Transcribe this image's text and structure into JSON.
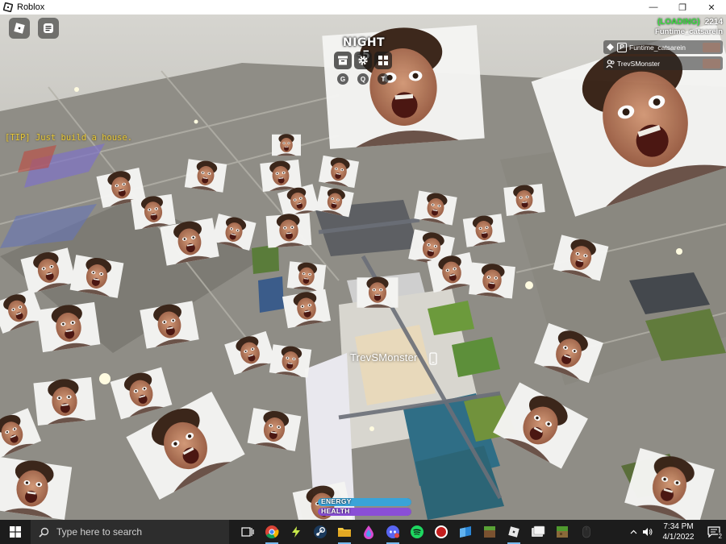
{
  "window": {
    "title": "Roblox",
    "controls": {
      "minimize": "—",
      "maximize": "❐",
      "close": "✕"
    }
  },
  "game": {
    "night_label": "NIGHT -5",
    "tip": "[TIP] Just build a house.",
    "toolbar": {
      "icons": [
        "archive-icon",
        "gear-icon",
        "grid-icon"
      ],
      "key_hints": [
        "G",
        "Q",
        "T"
      ]
    },
    "leaderboard": {
      "loading_status": "(LOADING)",
      "count": "2214",
      "local_player": "Funtime_catsarein",
      "players": [
        {
          "name": "Funtime_catsarein"
        },
        {
          "name": "TrevSMonster"
        }
      ]
    },
    "player_tag": "TrevSMonster",
    "stats": {
      "energy": {
        "label": "ENERGY",
        "level": 1.0,
        "color": "#3aa3d8"
      },
      "health": {
        "label": "HEALTH",
        "level": 1.0,
        "color": "#8a4fd6"
      }
    }
  },
  "taskbar": {
    "search_placeholder": "Type here to search",
    "apps": [
      {
        "name": "task-view-icon",
        "active": false
      },
      {
        "name": "chrome-icon",
        "active": true
      },
      {
        "name": "lightning-app-icon",
        "active": false
      },
      {
        "name": "steam-icon",
        "active": false
      },
      {
        "name": "file-explorer-icon",
        "active": true
      },
      {
        "name": "color-drop-app-icon",
        "active": false
      },
      {
        "name": "discord-icon",
        "active": true
      },
      {
        "name": "spotify-icon",
        "active": false
      },
      {
        "name": "record-app-icon",
        "active": false
      },
      {
        "name": "blue-cube-app-icon",
        "active": false
      },
      {
        "name": "minecraft-icon",
        "active": false
      },
      {
        "name": "roblox-icon",
        "active": true
      },
      {
        "name": "roblox-studio-icon",
        "active": false
      },
      {
        "name": "minecraft-launcher-icon",
        "active": false
      },
      {
        "name": "mouse-app-icon",
        "active": false
      }
    ],
    "tray": {
      "chevron": "^",
      "time": "7:34 PM",
      "date": "4/1/2022",
      "notification_count": "2"
    }
  }
}
